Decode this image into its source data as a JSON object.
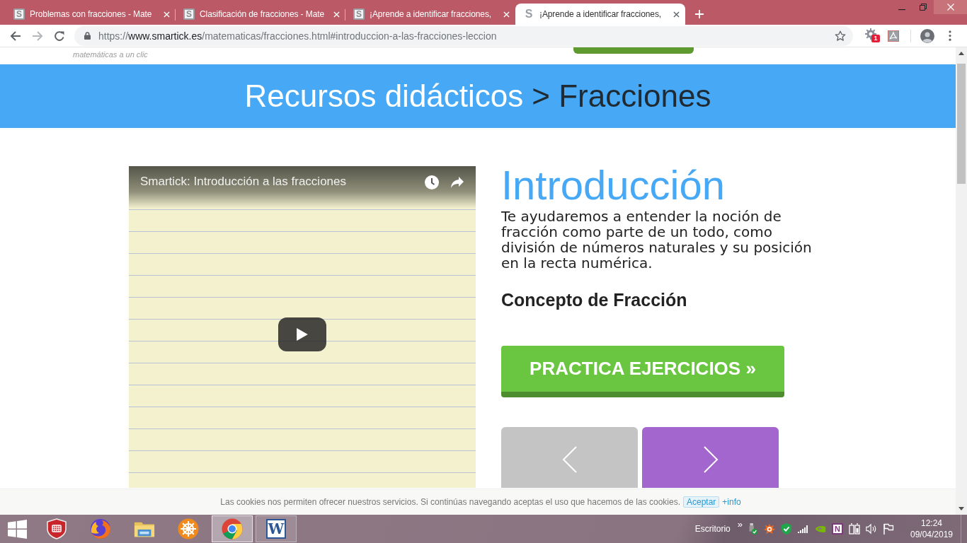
{
  "browser": {
    "tabs": [
      {
        "favicon": "S",
        "title": "Problemas con fracciones - Mate",
        "selected": false
      },
      {
        "favicon": "S",
        "title": "Clasificación de fracciones - Mate",
        "selected": false
      },
      {
        "favicon": "S",
        "title": "¡Aprende a identificar fracciones,",
        "selected": false
      },
      {
        "favicon": "S",
        "title": "¡Aprende a identificar fracciones,",
        "selected": true
      }
    ],
    "url": {
      "scheme": "https://",
      "host": "www.smartick.es",
      "path": "/matematicas/fracciones.html#introduccion-a-las-fracciones-leccion"
    },
    "extension_badge": "1"
  },
  "page": {
    "tagline": "matemáticas a un clic",
    "breadcrumb": {
      "section": "Recursos didácticos",
      "current": "> Fracciones"
    },
    "video": {
      "title": "Smartick: Introducción a las fracciones"
    },
    "lesson": {
      "heading": "Introducción",
      "intro": "Te ayudaremos a entender la noción de fracción como parte de un todo, como división de números naturales y su posición en la recta numérica.",
      "subheading": "Concepto de Fracción",
      "practice_button": "PRACTICA EJERCICIOS »",
      "nav": [
        {
          "kind": "prev",
          "disabled": true
        },
        {
          "kind": "next",
          "disabled": false
        }
      ]
    },
    "cookie_bar": {
      "message": "Las cookies nos permiten ofrecer nuestros servicios. Si continúas navegando aceptas el uso que hacemos de las cookies.",
      "accept_button": "Aceptar",
      "info_link": "+info"
    }
  },
  "taskbar": {
    "apps": [
      {
        "kind": "shield",
        "open": false,
        "selected": false
      },
      {
        "kind": "fox",
        "open": false,
        "selected": false
      },
      {
        "kind": "folder",
        "open": false,
        "selected": false
      },
      {
        "kind": "wheel",
        "open": false,
        "selected": false
      },
      {
        "kind": "browser",
        "open": true,
        "selected": true
      },
      {
        "kind": "document",
        "letter": "W",
        "open": true,
        "selected": false
      }
    ],
    "desktop_label": "Escritorio",
    "overflow": "»",
    "notes_letter": "N",
    "time": "12:24",
    "date": "09/04/2019"
  }
}
